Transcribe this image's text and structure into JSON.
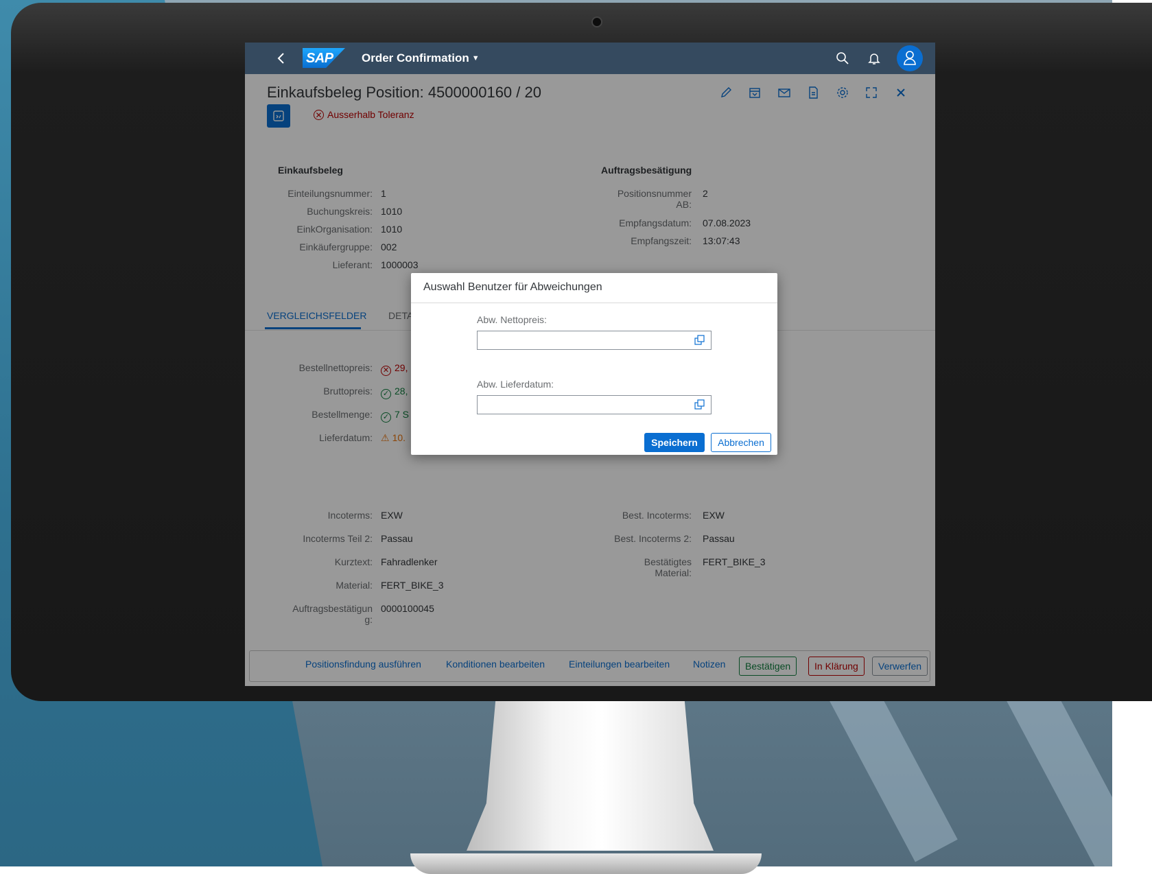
{
  "shell": {
    "title": "Order Confirmation"
  },
  "header": {
    "title": "Einkaufsbeleg Position: 4500000160 / 20",
    "status": "Ausserhalb Toleranz"
  },
  "einkaufsbeleg": {
    "title": "Einkaufsbeleg",
    "fields": [
      {
        "label": "Einteilungsnummer:",
        "value": "1"
      },
      {
        "label": "Buchungskreis:",
        "value": "1010"
      },
      {
        "label": "EinkOrganisation:",
        "value": "1010"
      },
      {
        "label": "Einkäufergruppe:",
        "value": "002"
      },
      {
        "label": "Lieferant:",
        "value": "1000003"
      }
    ]
  },
  "auftragsbestaetigung": {
    "title": "Auftragsbesätigung",
    "fields": [
      {
        "label1": "Positionsnummer",
        "label2": "AB:",
        "value": "2"
      },
      {
        "label": "Empfangsdatum:",
        "value": "07.08.2023"
      },
      {
        "label": "Empfangszeit:",
        "value": "13:07:43"
      }
    ]
  },
  "tabs": {
    "active": "VERGLEICHSFELDER",
    "second": "DETA"
  },
  "compare": [
    {
      "label": "Bestellnettopreis:",
      "value": "29,",
      "state": "error"
    },
    {
      "label": "Bruttopreis:",
      "value": "28,",
      "state": "success"
    },
    {
      "label": "Bestellmenge:",
      "value": "7 S",
      "state": "success"
    },
    {
      "label": "Lieferdatum:",
      "value": "10.",
      "state": "warning"
    }
  ],
  "left_details": [
    {
      "label": "Incoterms:",
      "value": "EXW"
    },
    {
      "label": "Incoterms Teil 2:",
      "value": "Passau"
    },
    {
      "label": "Kurztext:",
      "value": "Fahradlenker"
    },
    {
      "label": "Material:",
      "value": "FERT_BIKE_3"
    },
    {
      "label1": "Auftragsbestätigun",
      "label2": "g:",
      "value": "0000100045"
    }
  ],
  "right_details": [
    {
      "label": "Best. Incoterms:",
      "value": "EXW"
    },
    {
      "label": "Best. Incoterms 2:",
      "value": "Passau"
    },
    {
      "label1": "Bestätigtes",
      "label2": "Material:",
      "value": "FERT_BIKE_3"
    }
  ],
  "footer": {
    "positionsfindung": "Positionsfindung ausführen",
    "konditionen": "Konditionen bearbeiten",
    "einteilungen": "Einteilungen bearbeiten",
    "notizen": "Notizen",
    "bestaetigen": "Bestätigen",
    "in_klaerung": "In Klärung",
    "verwerfen": "Verwerfen"
  },
  "dialog": {
    "title": "Auswahl Benutzer für Abweichungen",
    "nettopreis_label": "Abw. Nettopreis:",
    "nettopreis_value": "",
    "lieferdatum_label": "Abw. Lieferdatum:",
    "lieferdatum_value": "",
    "save": "Speichern",
    "cancel": "Abbrechen"
  },
  "colors": {
    "shell": "#354a5f",
    "accent": "#0a6ed1",
    "error": "#bb0000",
    "success": "#107e3e",
    "warning": "#e9730c"
  }
}
